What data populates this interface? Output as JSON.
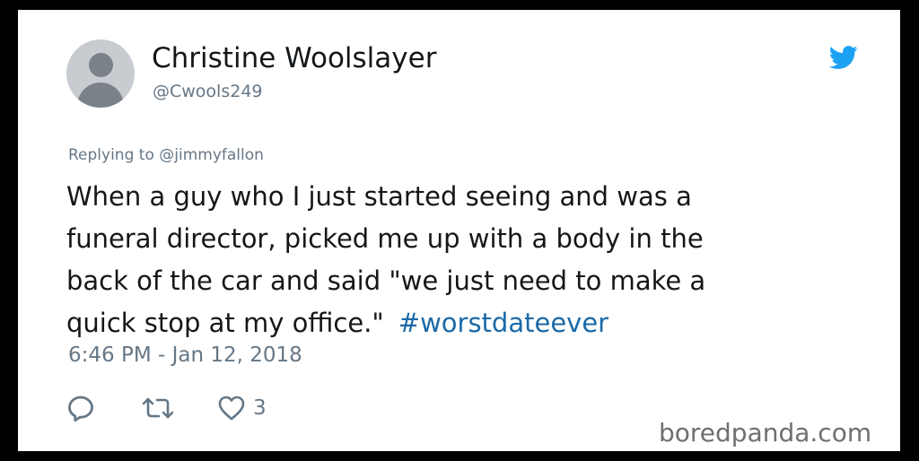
{
  "tweet": {
    "author": {
      "name": "Christine Woolslayer",
      "handle": "@Cwools249"
    },
    "reply_prefix": "Replying to",
    "reply_to": "@jimmyfallon",
    "text_lines": [
      "When a guy who I just started seeing and was a",
      "funeral director, picked me up with a body in the",
      "back of the car and said \"we just need to make a",
      "quick stop at my office.\""
    ],
    "hashtag": "#worstdateever",
    "timestamp": "6:46 PM - Jan 12, 2018",
    "actions": {
      "reply_icon": "reply-icon",
      "retweet_icon": "retweet-icon",
      "like_icon": "heart-icon",
      "like_count": "3"
    },
    "brand_icon": "twitter-bird-icon"
  },
  "watermark": "boredpanda.com",
  "colors": {
    "background": "#000000",
    "card": "#ffffff",
    "text": "#14171a",
    "muted": "#657786",
    "link": "#1b6aa8",
    "brand": "#1da1f2"
  }
}
